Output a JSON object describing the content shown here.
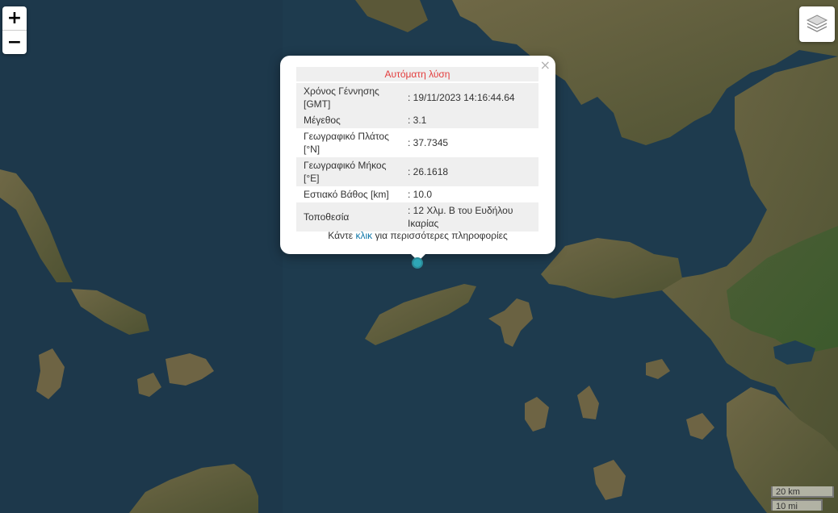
{
  "map": {
    "zoom_in_label": "+",
    "zoom_out_label": "−",
    "layers_icon": "layers-icon",
    "water_color": "#1f3a4c",
    "land_color": "#5e5a3a"
  },
  "popup": {
    "title": "Αυτόματη λύση",
    "close_label": "×",
    "rows": [
      {
        "label": "Χρόνος Γέννησης [GMT]",
        "value": ": 19/11/2023 14:16:44.64"
      },
      {
        "label": "Μέγεθος",
        "value": ": 3.1"
      },
      {
        "label": "Γεωγραφικό Πλάτος [°N]",
        "value": ": 37.7345"
      },
      {
        "label": "Γεωγραφικό Μήκος [°E]",
        "value": ": 26.1618"
      },
      {
        "label": "Εστιακό Βάθος [km]",
        "value": ": 10.0"
      },
      {
        "label": "Τοποθεσία",
        "value": ": 12 Χλμ. Β του Ευδήλου Ικαρίας"
      }
    ],
    "more_prefix": "Κάντε ",
    "more_link": "κλικ",
    "more_suffix": " για περισσότερες πληροφορίες"
  },
  "scale": {
    "km_label": "20 km",
    "mi_label": "10 mi"
  }
}
